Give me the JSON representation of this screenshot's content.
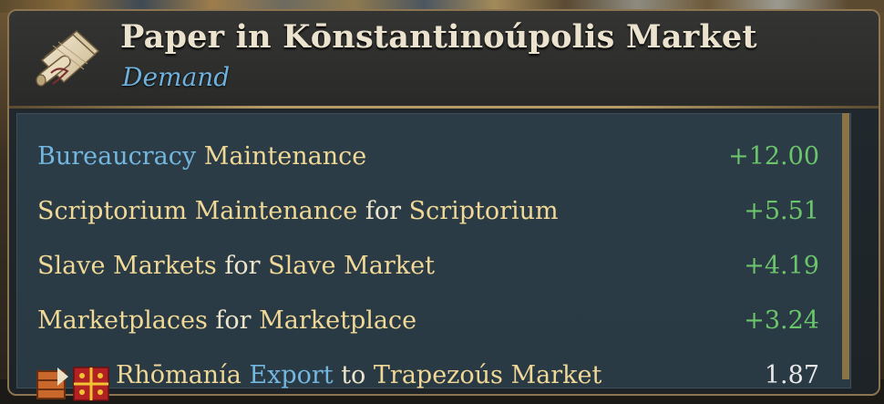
{
  "window": {
    "title": "Paper in Kōnstantinoúpolis Market",
    "subtitle": "Demand",
    "icon": "paper-goods-icon"
  },
  "rows": [
    {
      "parts": [
        {
          "text": "Bureaucracy",
          "style": "blue"
        },
        {
          "text": " Maintenance",
          "style": "gold"
        }
      ],
      "value": "+12.00",
      "value_color": "#6bc56b"
    },
    {
      "parts": [
        {
          "text": "Scriptorium Maintenance",
          "style": "gold"
        },
        {
          "text": " for ",
          "style": "plain"
        },
        {
          "text": "Scriptorium",
          "style": "gold"
        }
      ],
      "value": "+5.51",
      "value_color": "#6bc56b"
    },
    {
      "parts": [
        {
          "text": "Slave Markets",
          "style": "gold"
        },
        {
          "text": " for ",
          "style": "plain"
        },
        {
          "text": "Slave Market",
          "style": "gold"
        }
      ],
      "value": "+4.19",
      "value_color": "#6bc56b"
    },
    {
      "parts": [
        {
          "text": "Marketplaces",
          "style": "gold"
        },
        {
          "text": " for ",
          "style": "plain"
        },
        {
          "text": "Marketplace",
          "style": "gold"
        }
      ],
      "value": "+3.24",
      "value_color": "#6bc56b"
    },
    {
      "icons": [
        "trade-route-icon",
        "rhomania-flag-icon"
      ],
      "parts": [
        {
          "text": "Rhōmanía",
          "style": "gold"
        },
        {
          "text": " Export",
          "style": "blue"
        },
        {
          "text": " to ",
          "style": "plain"
        },
        {
          "text": "Trapezoús Market",
          "style": "gold"
        }
      ],
      "value": "1.87",
      "value_color": "#e8e8e8"
    }
  ],
  "colors": {
    "title": "#ece3cf",
    "subtitle": "#6eb1dc",
    "gold_text": "#f0d897",
    "blue_text": "#73b6df",
    "positive": "#6bc56b",
    "border": "#8c7550"
  }
}
